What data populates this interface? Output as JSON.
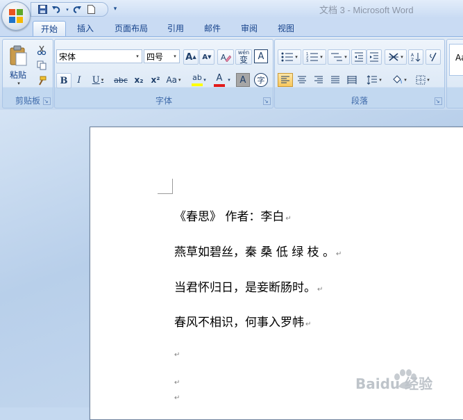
{
  "window": {
    "title": "文档 3 - Microsoft Word"
  },
  "qat": {
    "save_icon": "save-icon",
    "undo_icon": "undo-icon",
    "redo_icon": "redo-icon",
    "new_icon": "new-doc-icon",
    "customize_icon": "customize-qat-icon"
  },
  "tabs": [
    {
      "label": "开始",
      "active": true
    },
    {
      "label": "插入"
    },
    {
      "label": "页面布局"
    },
    {
      "label": "引用"
    },
    {
      "label": "邮件"
    },
    {
      "label": "审阅"
    },
    {
      "label": "视图"
    }
  ],
  "clipboard": {
    "paste_label": "粘贴",
    "group_label": "剪贴板"
  },
  "font": {
    "name": "宋体",
    "size": "四号",
    "group_label": "字体",
    "bold": "B",
    "italic": "I",
    "underline": "U",
    "strike": "abc",
    "subscript": "x₂",
    "superscript": "x²",
    "change_case": "Aa",
    "grow": "A",
    "shrink": "A",
    "clear": "A",
    "phonetic": "wén",
    "phonetic_char": "变",
    "border_char": "A",
    "highlight": "ab",
    "font_color": "A",
    "shade_char": "A",
    "enclose": "字"
  },
  "paragraph": {
    "group_label": "段落"
  },
  "styles": {
    "preview": "Aa"
  },
  "colors": {
    "accent": "#15428b",
    "font_color_bar": "#e21a1a",
    "highlight_bar": "#ffff00"
  },
  "document": {
    "lines": [
      "《春思》 作者：李白",
      "燕草如碧丝，秦 桑 低 绿 枝 。",
      "当君怀归日，是妾断肠时。",
      "春风不相识，何事入罗帏"
    ],
    "paragraph_mark": "↵"
  },
  "watermark": {
    "text": "Baidu 经验"
  }
}
